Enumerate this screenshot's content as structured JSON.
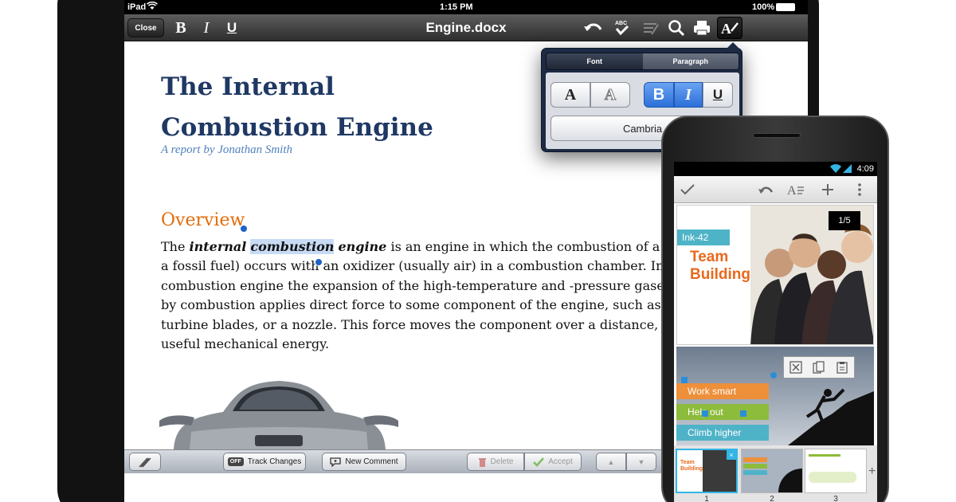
{
  "ipad": {
    "status": {
      "carrier": "iPad",
      "time": "1:15 PM",
      "battery": "100%"
    },
    "toolbar": {
      "close_label": "Close",
      "bold_label": "B",
      "italic_label": "I",
      "underline_label": "U",
      "doc_title": "Engine.docx"
    },
    "document": {
      "title_line1": "The Internal",
      "title_line2": "Combustion Engine",
      "subtitle": "A report by Jonathan Smith",
      "heading": "Overview",
      "para_the": "The ",
      "para_internal": "internal",
      "para_combustion": "combustion",
      "para_engine": "engine",
      "para_rest1": " is an engine in which the combustion of a fuel (n",
      "para_line2": "a fossil fuel) occurs with an oxidizer (usually air) in a combustion chamber. In an i",
      "para_line3": "combustion engine the expansion of the high-temperature and -pressure gases pro",
      "para_line4": "by combustion applies direct force to some component of the engine, such as pisto",
      "para_line5": "turbine blades, or a nozzle. This force moves the component over a distance, gener",
      "para_line6": "useful mechanical energy."
    },
    "bottombar": {
      "track_off": "OFF",
      "track_changes": "Track Changes",
      "new_comment": "New Comment",
      "delete": "Delete",
      "accept": "Accept",
      "up": "▲",
      "down": "▼"
    },
    "popover": {
      "tab_font": "Font",
      "tab_paragraph": "Paragraph",
      "btn_a": "A",
      "btn_a_outline": "A",
      "btn_bold": "B",
      "btn_italic": "I",
      "btn_underline": "U",
      "font_name": "Cambria"
    }
  },
  "android": {
    "time": "4:09",
    "slide1": {
      "tag": "Ink-42",
      "title_line1": "Team",
      "title_line2": "Building",
      "page_indicator": "1/5"
    },
    "slide2": {
      "bar1": "Work smart",
      "bar2": "Help out",
      "bar3": "Climb higher"
    },
    "thumbnails": [
      "1",
      "2",
      "3"
    ],
    "add": "+"
  },
  "colors": {
    "title_navy": "#1f3864",
    "subtitle_blue": "#4f81bd",
    "heading_orange": "#e36c09",
    "selection_blue": "#c8dbf5",
    "team_orange": "#e8691c",
    "ink_teal": "#4fb3c8",
    "holo_blue": "#33b5e5"
  }
}
